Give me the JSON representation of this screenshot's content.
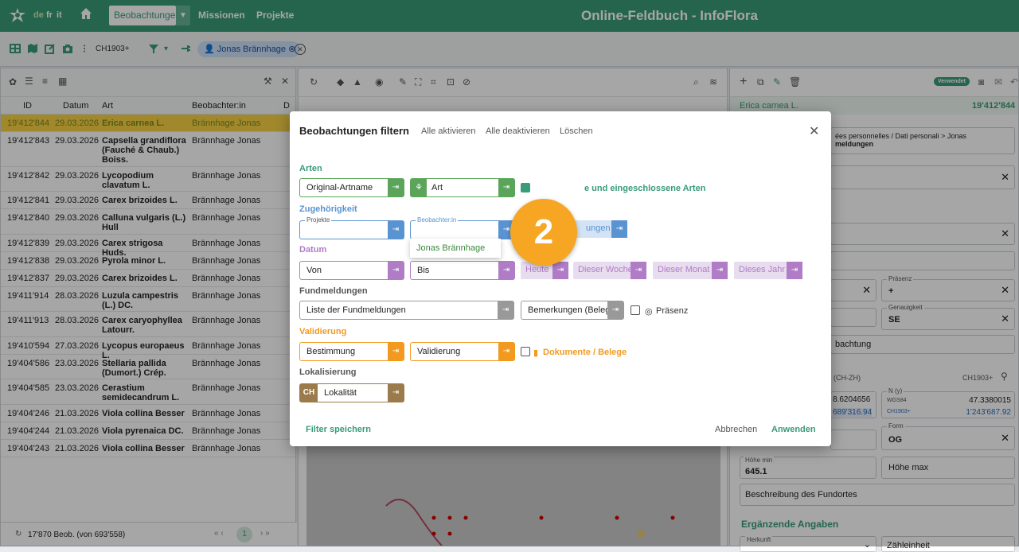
{
  "header": {
    "langs": [
      "de",
      "fr",
      "it"
    ],
    "nav_dropdown": "Beobachtungen",
    "nav_links": [
      "Missionen",
      "Projekte"
    ],
    "title": "Online-Feldbuch - InfoFlora"
  },
  "toolbar": {
    "crs": "CH1903+",
    "filter_chip": "Jonas Brännhage"
  },
  "list": {
    "columns": [
      "ID",
      "Datum",
      "Art",
      "Beobachter:in",
      "D"
    ],
    "rows": [
      {
        "id": "19'412'844",
        "date": "29.03.2026",
        "art": "Erica carnea L.",
        "obs": "Brännhage Jonas"
      },
      {
        "id": "19'412'843",
        "date": "29.03.2026",
        "art": "Capsella grandiflora (Fauché & Chaub.) Boiss.",
        "obs": "Brännhage Jonas"
      },
      {
        "id": "19'412'842",
        "date": "29.03.2026",
        "art": "Lycopodium clavatum L.",
        "obs": "Brännhage Jonas"
      },
      {
        "id": "19'412'841",
        "date": "29.03.2026",
        "art": "Carex brizoides L.",
        "obs": "Brännhage Jonas"
      },
      {
        "id": "19'412'840",
        "date": "29.03.2026",
        "art": "Calluna vulgaris (L.) Hull",
        "obs": "Brännhage Jonas"
      },
      {
        "id": "19'412'839",
        "date": "29.03.2026",
        "art": "Carex strigosa Huds.",
        "obs": "Brännhage Jonas"
      },
      {
        "id": "19'412'838",
        "date": "29.03.2026",
        "art": "Pyrola minor L.",
        "obs": "Brännhage Jonas"
      },
      {
        "id": "19'412'837",
        "date": "29.03.2026",
        "art": "Carex brizoides L.",
        "obs": "Brännhage Jonas"
      },
      {
        "id": "19'411'914",
        "date": "28.03.2026",
        "art": "Luzula campestris (L.) DC.",
        "obs": "Brännhage Jonas"
      },
      {
        "id": "19'411'913",
        "date": "28.03.2026",
        "art": "Carex caryophyllea Latourr.",
        "obs": "Brännhage Jonas"
      },
      {
        "id": "19'410'594",
        "date": "27.03.2026",
        "art": "Lycopus europaeus L.",
        "obs": "Brännhage Jonas"
      },
      {
        "id": "19'404'586",
        "date": "23.03.2026",
        "art": "Stellaria pallida (Dumort.) Crép.",
        "obs": "Brännhage Jonas"
      },
      {
        "id": "19'404'585",
        "date": "23.03.2026",
        "art": "Cerastium semidecandrum L.",
        "obs": "Brännhage Jonas"
      },
      {
        "id": "19'404'246",
        "date": "21.03.2026",
        "art": "Viola collina Besser",
        "obs": "Brännhage Jonas"
      },
      {
        "id": "19'404'244",
        "date": "21.03.2026",
        "art": "Viola pyrenaica DC.",
        "obs": "Brännhage Jonas"
      },
      {
        "id": "19'404'243",
        "date": "21.03.2026",
        "art": "Viola collina Besser",
        "obs": "Brännhage Jonas"
      }
    ],
    "footer": "17'870 Beob. (von 693'558)",
    "page": "1"
  },
  "right": {
    "status": "Verwendet",
    "species": "Erica carnea L.",
    "id": "19'412'844",
    "source": "ées personnelles / Dati personali > Jonas",
    "source2": "meldungen",
    "praesenz_label": "Präsenz",
    "praesenz_val": "+",
    "genauigkeit_label": "Genauigkeit",
    "genauigkeit_val": "SE",
    "beobachtung": "bachtung",
    "chzh": "(CH-ZH)",
    "crs": "CH1903+",
    "x_val": "8.6204656",
    "x_ch": "689'316.94",
    "n_label": "N (y)",
    "n_sub": "WGS84",
    "n_val": "47.3380015",
    "n_ch": "1'243'687.92",
    "n_crs": "CH1903+",
    "form_label": "Form",
    "form_val": "OG",
    "hoehe_min_label": "Höhe min",
    "hoehe_min": "645.1",
    "hoehe_max": "Höhe max",
    "fundort": "Beschreibung des Fundortes",
    "erg": "Ergänzende Angaben",
    "herkunft": "Herkunft",
    "zaehl": "Zähleinheit"
  },
  "dialog": {
    "title": "Beobachtungen filtern",
    "aktivieren": "Alle aktivieren",
    "deaktivieren": "Alle deaktivieren",
    "loeschen": "Löschen",
    "arten": "Arten",
    "original": "Original-Artname",
    "art": "Art",
    "eingeschl": "e und eingeschlossene Arten",
    "zugeh": "Zugehörigkeit",
    "projekte": "Projekte",
    "beobachter": "Beobachter:in",
    "ungen": "ungen",
    "datum": "Datum",
    "von": "Von",
    "bis": "Bis",
    "heute": "Heute",
    "woche": "Dieser Woche",
    "monat": "Dieser Monat",
    "jahr": "Dieses Jahr",
    "fundmeldungen": "Fundmeldungen",
    "liste": "Liste der Fundmeldungen",
    "bemerkungen": "Bemerkungen (Beleg)",
    "praesenz": "Präsenz",
    "validierung": "Validierung",
    "bestimmung": "Bestimmung",
    "validierung_f": "Validierung",
    "dokumente": "Dokumente / Belege",
    "lokal": "Lokalisierung",
    "ch": "CH",
    "lokalitaet": "Lokalität",
    "speichern": "Filter speichern",
    "abbrechen": "Abbrechen",
    "anwenden": "Anwenden",
    "suggestion": "Jonas Brännhage",
    "step": "2"
  },
  "colors": {
    "green": "#3a9b78",
    "blue": "#5a93d1",
    "purple": "#b07cc6",
    "orange": "#f29a1f",
    "brown": "#9b7a4b",
    "lightgreen": "#5aa55a"
  }
}
